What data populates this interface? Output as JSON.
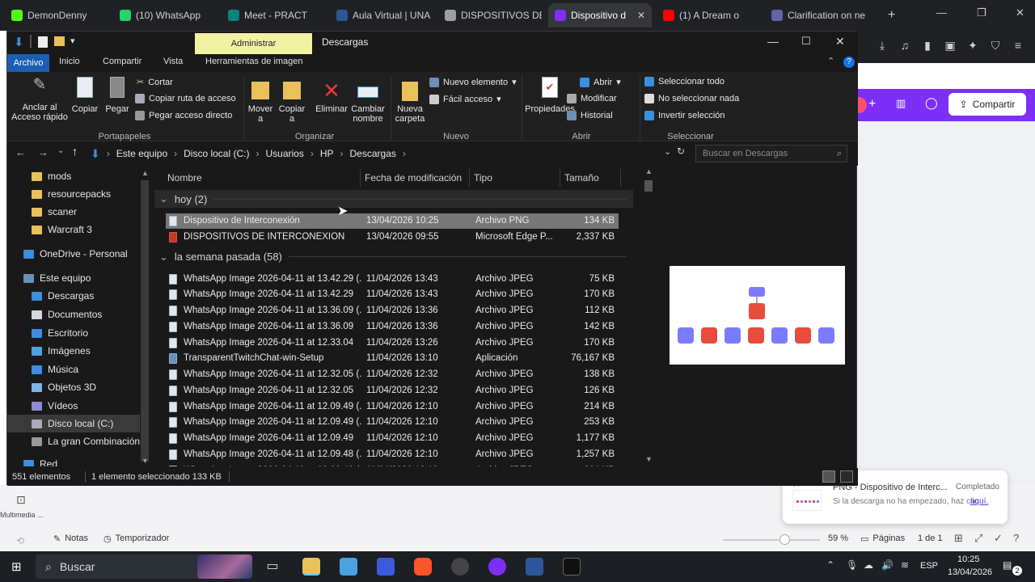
{
  "browser": {
    "tabs": [
      {
        "label": "DemonDenny",
        "color": "#53fc18"
      },
      {
        "label": "(10) WhatsApp",
        "color": "#25d366"
      },
      {
        "label": "Meet - PRACT",
        "color": "#00897b"
      },
      {
        "label": "Aula Virtual | UNA",
        "color": "#2b5797"
      },
      {
        "label": "DISPOSITIVOS DE",
        "color": "#9e9e9e"
      },
      {
        "label": "Dispositivo d",
        "color": "#7b2ff7"
      },
      {
        "label": "(1) A Dream o",
        "color": "#ff0000"
      },
      {
        "label": "Clarification on ne",
        "color": "#6264a7"
      }
    ],
    "new_tab": "+"
  },
  "canva": {
    "share_label": "Compartir",
    "bottom": {
      "notes": "Notas",
      "timer": "Temporizador",
      "zoom": "59 %",
      "pages": "Páginas",
      "page_of": "1 de 1",
      "side_label": "Multimedia ..."
    },
    "download": {
      "title": "PNG - Dispositivo de Interc...",
      "status": "Completado",
      "hint": "Si la descarga no ha empezado, haz clic",
      "link": "aquí."
    }
  },
  "explorer": {
    "title_tool": "Administrar",
    "title": "Descargas",
    "ribbon_tabs": [
      "Archivo",
      "Inicio",
      "Compartir",
      "Vista",
      "Herramientas de imagen"
    ],
    "ribbon": {
      "anclar": "Anclar al Acceso rápido",
      "copiar": "Copiar",
      "pegar": "Pegar",
      "cortar": "Cortar",
      "copiar_ruta": "Copiar ruta de acceso",
      "pegar_acceso": "Pegar acceso directo",
      "mover": "Mover a",
      "copiar_a": "Copiar a",
      "eliminar": "Eliminar",
      "cambiar": "Cambiar nombre",
      "nueva_carpeta": "Nueva carpeta",
      "nuevo_elemento": "Nuevo elemento",
      "facil_acceso": "Fácil acceso",
      "propiedades": "Propiedades",
      "abrir": "Abrir",
      "modificar": "Modificar",
      "historial": "Historial",
      "sel_todo": "Seleccionar todo",
      "sel_nada": "No seleccionar nada",
      "invertir": "Invertir selección",
      "groups": [
        "Portapapeles",
        "Organizar",
        "Nuevo",
        "Abrir",
        "Seleccionar"
      ]
    },
    "breadcrumb": [
      "Este equipo",
      "Disco local (C:)",
      "Usuarios",
      "HP",
      "Descargas"
    ],
    "search_placeholder": "Buscar en Descargas",
    "nav": [
      {
        "label": "mods",
        "kind": "folder"
      },
      {
        "label": "resourcepacks",
        "kind": "folder"
      },
      {
        "label": "scaner",
        "kind": "folder"
      },
      {
        "label": "Warcraft 3",
        "kind": "folder"
      },
      {
        "label": "OneDrive - Personal",
        "kind": "cloud"
      },
      {
        "label": "Este equipo",
        "kind": "pc"
      },
      {
        "label": "Descargas",
        "kind": "download"
      },
      {
        "label": "Documentos",
        "kind": "docs"
      },
      {
        "label": "Escritorio",
        "kind": "desktop"
      },
      {
        "label": "Imágenes",
        "kind": "pics"
      },
      {
        "label": "Música",
        "kind": "music"
      },
      {
        "label": "Objetos 3D",
        "kind": "3d"
      },
      {
        "label": "Vídeos",
        "kind": "video"
      },
      {
        "label": "Disco local (C:)",
        "kind": "drive"
      },
      {
        "label": "La gran Combinación (",
        "kind": "drive2"
      },
      {
        "label": "Red",
        "kind": "net"
      }
    ],
    "columns": [
      "Nombre",
      "Fecha de modificación",
      "Tipo",
      "Tamaño"
    ],
    "groups": [
      {
        "label": "hoy (2)",
        "rows": [
          {
            "name": "Dispositivo de Interconexión",
            "date": "13/04/2026 10:25",
            "type": "Archivo PNG",
            "size": "134 KB",
            "icon": "img",
            "selected": true
          },
          {
            "name": "DISPOSITIVOS DE INTERCONEXION",
            "date": "13/04/2026 09:55",
            "type": "Microsoft Edge P...",
            "size": "2,337 KB",
            "icon": "pdf",
            "selected": false
          }
        ]
      },
      {
        "label": "la semana pasada (58)",
        "rows": [
          {
            "name": "WhatsApp Image 2026-04-11 at 13.42.29 (...",
            "date": "11/04/2026 13:43",
            "type": "Archivo JPEG",
            "size": "75 KB",
            "icon": "img"
          },
          {
            "name": "WhatsApp Image 2026-04-11 at 13.42.29",
            "date": "11/04/2026 13:43",
            "type": "Archivo JPEG",
            "size": "170 KB",
            "icon": "img"
          },
          {
            "name": "WhatsApp Image 2026-04-11 at 13.36.09 (...",
            "date": "11/04/2026 13:36",
            "type": "Archivo JPEG",
            "size": "112 KB",
            "icon": "img"
          },
          {
            "name": "WhatsApp Image 2026-04-11 at 13.36.09",
            "date": "11/04/2026 13:36",
            "type": "Archivo JPEG",
            "size": "142 KB",
            "icon": "img"
          },
          {
            "name": "WhatsApp Image 2026-04-11 at 12.33.04",
            "date": "11/04/2026 13:26",
            "type": "Archivo JPEG",
            "size": "170 KB",
            "icon": "img"
          },
          {
            "name": "TransparentTwitchChat-win-Setup",
            "date": "11/04/2026 13:10",
            "type": "Aplicación",
            "size": "76,167 KB",
            "icon": "app"
          },
          {
            "name": "WhatsApp Image 2026-04-11 at 12.32.05 (...",
            "date": "11/04/2026 12:32",
            "type": "Archivo JPEG",
            "size": "138 KB",
            "icon": "img"
          },
          {
            "name": "WhatsApp Image 2026-04-11 at 12.32.05",
            "date": "11/04/2026 12:32",
            "type": "Archivo JPEG",
            "size": "126 KB",
            "icon": "img"
          },
          {
            "name": "WhatsApp Image 2026-04-11 at 12.09.49 (...",
            "date": "11/04/2026 12:10",
            "type": "Archivo JPEG",
            "size": "214 KB",
            "icon": "img"
          },
          {
            "name": "WhatsApp Image 2026-04-11 at 12.09.49 (...",
            "date": "11/04/2026 12:10",
            "type": "Archivo JPEG",
            "size": "253 KB",
            "icon": "img"
          },
          {
            "name": "WhatsApp Image 2026-04-11 at 12.09.49",
            "date": "11/04/2026 12:10",
            "type": "Archivo JPEG",
            "size": "1,177 KB",
            "icon": "img"
          },
          {
            "name": "WhatsApp Image 2026-04-11 at 12.09.48 (...",
            "date": "11/04/2026 12:10",
            "type": "Archivo JPEG",
            "size": "1,257 KB",
            "icon": "img"
          },
          {
            "name": "WhatsApp Image 2026-04-11 at 12.09.48 (...",
            "date": "11/04/2026 12:10",
            "type": "Archivo JPEG",
            "size": "304 KB",
            "icon": "img"
          }
        ]
      }
    ],
    "status": {
      "count": "551 elementos",
      "selection": "1 elemento seleccionado  133 KB"
    }
  },
  "taskbar": {
    "search": "Buscar",
    "lang": "ESP",
    "time": "10:25",
    "date": "13/04/2026",
    "notif_count": "2"
  }
}
